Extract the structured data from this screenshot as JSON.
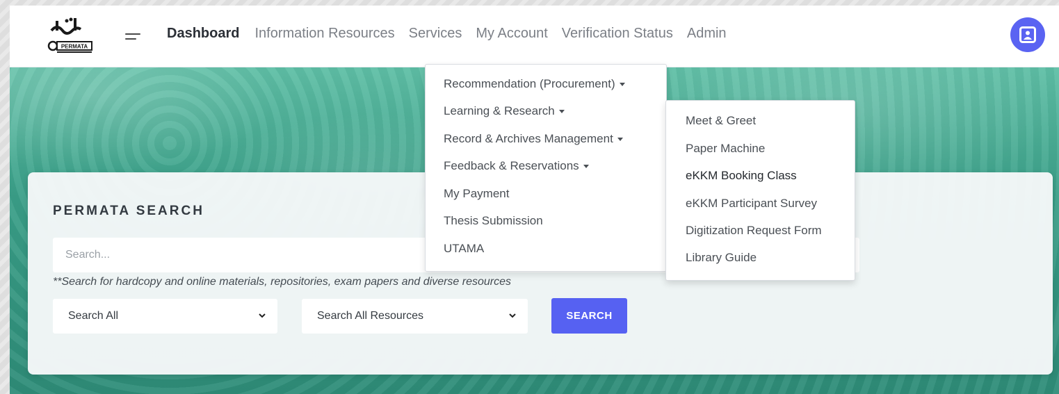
{
  "logo": {
    "label": "PERMATA"
  },
  "nav": {
    "items": [
      {
        "label": "Dashboard",
        "active": true
      },
      {
        "label": "Information Resources",
        "active": false
      },
      {
        "label": "Services",
        "active": false
      },
      {
        "label": "My Account",
        "active": false
      },
      {
        "label": "Verification Status",
        "active": false
      },
      {
        "label": "Admin",
        "active": false
      }
    ],
    "menu_icon": "hamburger-icon",
    "user_icon": "user-profile-icon"
  },
  "services_menu": {
    "items": [
      {
        "label": "Recommendation (Procurement)",
        "has_submenu": true
      },
      {
        "label": "Learning & Research",
        "has_submenu": true
      },
      {
        "label": "Record & Archives Management",
        "has_submenu": true
      },
      {
        "label": "Feedback & Reservations",
        "has_submenu": true
      },
      {
        "label": "My Payment",
        "has_submenu": false
      },
      {
        "label": "Thesis Submission",
        "has_submenu": false
      },
      {
        "label": "UTAMA",
        "has_submenu": false
      }
    ]
  },
  "submenu": {
    "items": [
      {
        "label": "Meet & Greet"
      },
      {
        "label": "Paper Machine"
      },
      {
        "label": "eKKM Booking Class"
      },
      {
        "label": "eKKM Participant Survey"
      },
      {
        "label": "Digitization Request Form"
      },
      {
        "label": "Library Guide"
      }
    ]
  },
  "search": {
    "title": "PERMATA SEARCH",
    "placeholder": "Search...",
    "value": "",
    "hint": "**Search for hardcopy and online materials, repositories, exam papers and diverse resources",
    "scope_selected": "Search All",
    "resource_selected": "Search All Resources",
    "button_label": "SEARCH"
  },
  "colors": {
    "accent": "#5661f2",
    "hero_teal": "#3a9f88",
    "nav_active": "#2b2f36",
    "nav_inactive": "#7b7f86"
  }
}
